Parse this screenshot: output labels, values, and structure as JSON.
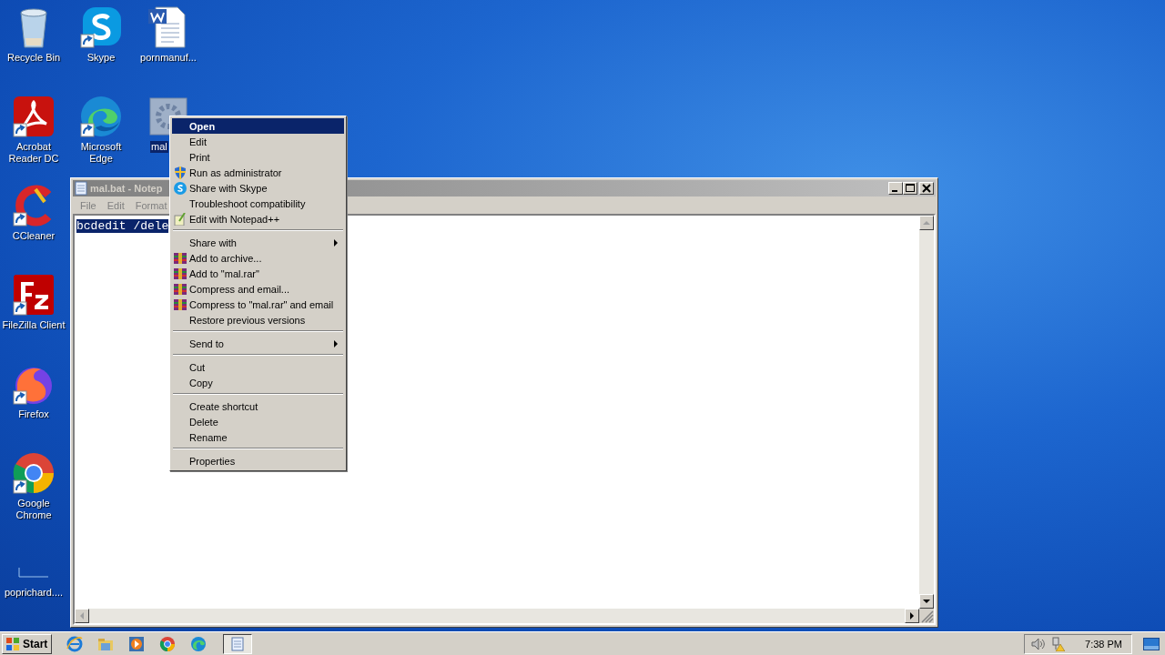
{
  "desktop": {
    "columns": [
      [
        {
          "label": "Recycle Bin",
          "kind": "recycle",
          "shortcut": false,
          "selected": false
        },
        {
          "label": "Acrobat Reader DC",
          "kind": "acrobat",
          "shortcut": true,
          "selected": false
        },
        {
          "label": "CCleaner",
          "kind": "ccleaner",
          "shortcut": true,
          "selected": false
        },
        {
          "label": "FileZilla Client",
          "kind": "filezilla",
          "shortcut": true,
          "selected": false
        },
        {
          "label": "Firefox",
          "kind": "firefox",
          "shortcut": true,
          "selected": false
        },
        {
          "label": "Google Chrome",
          "kind": "chrome",
          "shortcut": true,
          "selected": false
        },
        {
          "label": "poprichard....",
          "kind": "blank",
          "shortcut": false,
          "selected": false
        }
      ],
      [
        {
          "label": "Skype",
          "kind": "skype",
          "shortcut": true,
          "selected": false
        },
        {
          "label": "Microsoft Edge",
          "kind": "edge",
          "shortcut": true,
          "selected": false
        }
      ],
      [
        {
          "label": "pornmanuf...",
          "kind": "word",
          "shortcut": false,
          "selected": false
        },
        {
          "label": "mal",
          "kind": "batch",
          "shortcut": false,
          "selected": true
        }
      ]
    ]
  },
  "notepad": {
    "title": "mal.bat - Notep",
    "active": false,
    "menus": [
      "File",
      "Edit",
      "Format"
    ],
    "text": "bcdedit /dele",
    "text_selected": true
  },
  "context_menu": {
    "groups": [
      [
        {
          "label": "Open",
          "kind": "plain",
          "default": true,
          "selected": true,
          "submenu": false
        },
        {
          "label": "Edit",
          "kind": "plain",
          "default": false,
          "selected": false,
          "submenu": false
        },
        {
          "label": "Print",
          "kind": "plain",
          "default": false,
          "selected": false,
          "submenu": false
        },
        {
          "label": "Run as administrator",
          "kind": "shield",
          "default": false,
          "selected": false,
          "submenu": false
        },
        {
          "label": "Share with Skype",
          "kind": "skype",
          "default": false,
          "selected": false,
          "submenu": false
        },
        {
          "label": "Troubleshoot compatibility",
          "kind": "plain",
          "default": false,
          "selected": false,
          "submenu": false
        },
        {
          "label": "Edit with Notepad++",
          "kind": "notepadpp",
          "default": false,
          "selected": false,
          "submenu": false
        }
      ],
      [
        {
          "label": "Share with",
          "kind": "plain",
          "default": false,
          "selected": false,
          "submenu": true
        },
        {
          "label": "Add to archive...",
          "kind": "winrar",
          "default": false,
          "selected": false,
          "submenu": false
        },
        {
          "label": "Add to \"mal.rar\"",
          "kind": "winrar",
          "default": false,
          "selected": false,
          "submenu": false
        },
        {
          "label": "Compress and email...",
          "kind": "winrar",
          "default": false,
          "selected": false,
          "submenu": false
        },
        {
          "label": "Compress to \"mal.rar\" and email",
          "kind": "winrar",
          "default": false,
          "selected": false,
          "submenu": false
        },
        {
          "label": "Restore previous versions",
          "kind": "plain",
          "default": false,
          "selected": false,
          "submenu": false
        }
      ],
      [
        {
          "label": "Send to",
          "kind": "plain",
          "default": false,
          "selected": false,
          "submenu": true
        }
      ],
      [
        {
          "label": "Cut",
          "kind": "plain",
          "default": false,
          "selected": false,
          "submenu": false
        },
        {
          "label": "Copy",
          "kind": "plain",
          "default": false,
          "selected": false,
          "submenu": false
        }
      ],
      [
        {
          "label": "Create shortcut",
          "kind": "plain",
          "default": false,
          "selected": false,
          "submenu": false
        },
        {
          "label": "Delete",
          "kind": "plain",
          "default": false,
          "selected": false,
          "submenu": false
        },
        {
          "label": "Rename",
          "kind": "plain",
          "default": false,
          "selected": false,
          "submenu": false
        }
      ],
      [
        {
          "label": "Properties",
          "kind": "plain",
          "default": false,
          "selected": false,
          "submenu": false
        }
      ]
    ]
  },
  "taskbar": {
    "start": "Start",
    "quick_launch": [
      {
        "kind": "ie"
      },
      {
        "kind": "explorer"
      },
      {
        "kind": "media"
      },
      {
        "kind": "chrome"
      },
      {
        "kind": "edge"
      }
    ],
    "tasks": [
      {
        "kind": "notepad",
        "selected": true
      }
    ],
    "clock": "7:38 PM"
  }
}
